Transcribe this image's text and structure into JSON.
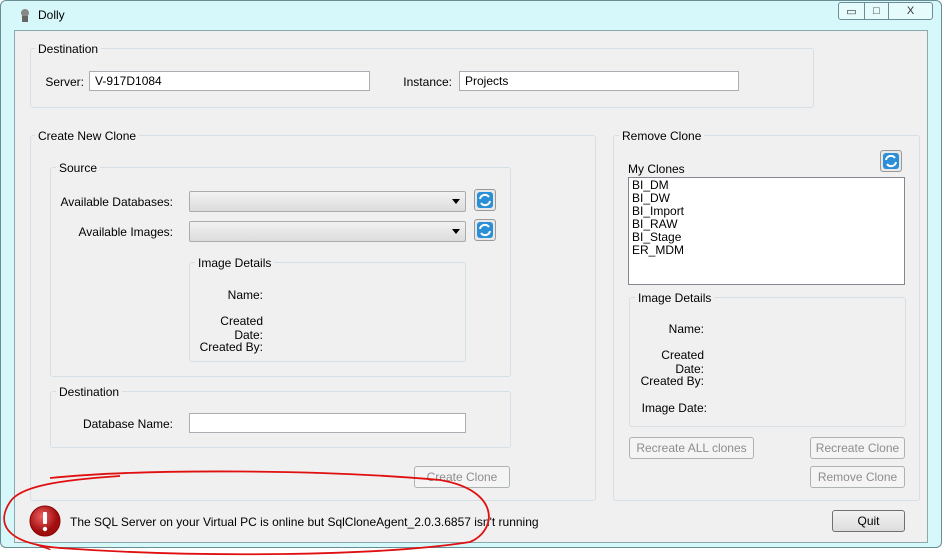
{
  "window": {
    "title": "Dolly",
    "minimize": "▭",
    "maximize": "□",
    "close": "X"
  },
  "destination": {
    "label": "Destination",
    "server_label": "Server:",
    "server_value": "V-917D1084",
    "instance_label": "Instance:",
    "instance_value": "Projects"
  },
  "create": {
    "label": "Create New Clone",
    "source": {
      "label": "Source",
      "available_databases_label": "Available Databases:",
      "available_databases_value": "",
      "available_images_label": "Available Images:",
      "available_images_value": "",
      "image_details": {
        "label": "Image Details",
        "name_label": "Name:",
        "created_date_label": "Created Date:",
        "created_by_label": "Created By:"
      }
    },
    "destination": {
      "label": "Destination",
      "database_name_label": "Database Name:",
      "database_name_value": ""
    },
    "create_button": "Create Clone"
  },
  "remove": {
    "label": "Remove Clone",
    "my_clones_label": "My Clones",
    "clones": [
      "BI_DM",
      "BI_DW",
      "BI_Import",
      "BI_RAW",
      "BI_Stage",
      "ER_MDM"
    ],
    "image_details": {
      "label": "Image Details",
      "name_label": "Name:",
      "created_date_label": "Created Date:",
      "created_by_label": "Created By:",
      "image_date_label": "Image Date:"
    },
    "recreate_all_button": "Recreate ALL clones",
    "recreate_button": "Recreate Clone",
    "remove_button": "Remove Clone"
  },
  "status": {
    "message": "The SQL Server on your Virtual PC is online but SqlCloneAgent_2.0.3.6857 isn't running",
    "icon": "error-icon",
    "icon_color": "#c81e1e"
  },
  "quit_button": "Quit",
  "annotation_color": "#e01010"
}
